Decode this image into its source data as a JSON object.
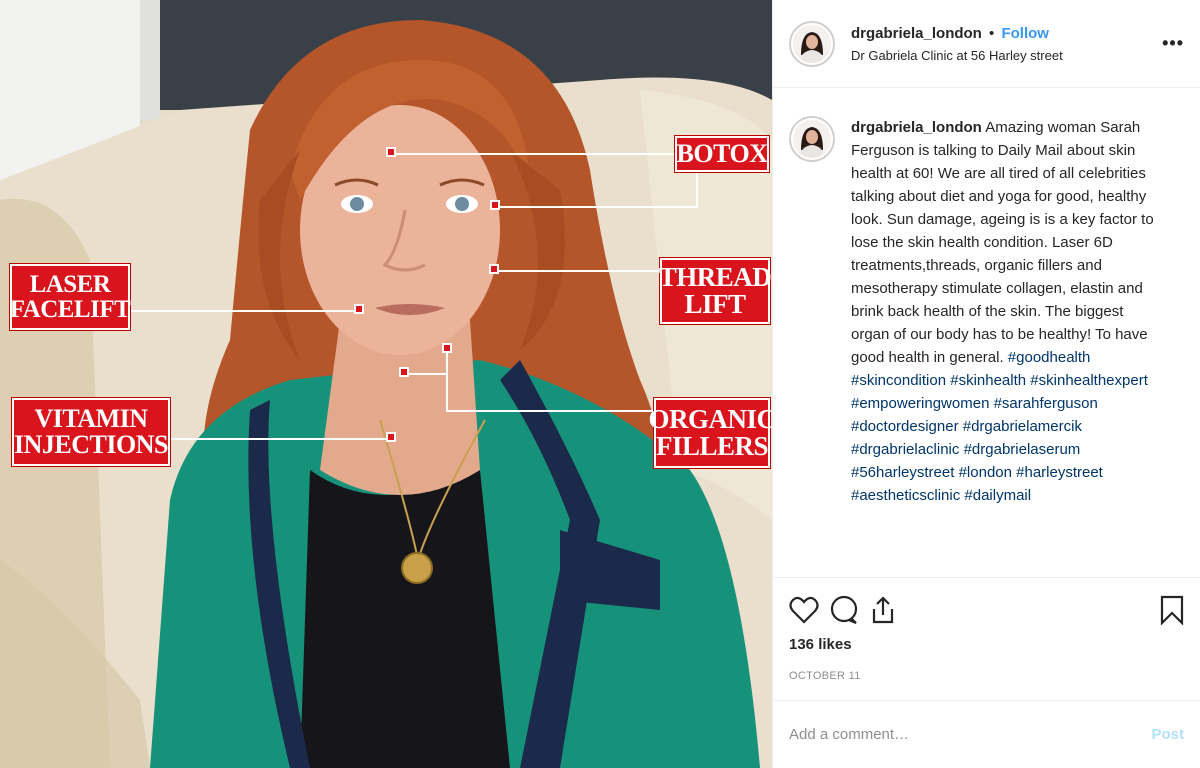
{
  "photo": {
    "callouts": [
      {
        "id": "botox",
        "text": "BOTOX"
      },
      {
        "id": "laser",
        "text": "LASER\nFACELIFT"
      },
      {
        "id": "thread",
        "text": "THREAD\nLIFT"
      },
      {
        "id": "vitamin",
        "text": "VITAMIN\nINJECTIONS"
      },
      {
        "id": "organic",
        "text": "ORGANIC\nFILLERS"
      }
    ]
  },
  "header": {
    "username": "drgabriela_london",
    "separator": "•",
    "follow_label": "Follow",
    "location": "Dr Gabriela Clinic at 56 Harley street",
    "more_label": "•••"
  },
  "caption": {
    "username": "drgabriela_london",
    "text": "Amazing woman Sarah Ferguson is talking to Daily Mail about skin health at 60! We are all tired of all celebrities talking about diet and yoga for good, healthy look. Sun damage, ageing is is a key factor to lose the skin health condition. Laser 6D treatments,threads, organic fillers and mesotherapy stimulate collagen, elastin and brink back health of the skin. The biggest organ of our body has to be healthy! To have good health in general.",
    "hashtags": [
      "#goodhealth",
      "#skincondition",
      "#skinhealth",
      "#skinhealthexpert",
      "#empoweringwomen",
      "#sarahferguson",
      "#doctordesigner",
      "#drgabrielamercik",
      "#drgabrielaclinic",
      "#drgabrielaserum",
      "#56harleystreet",
      "#london",
      "#harleystreet",
      "#aestheticsclinic",
      "#dailymail"
    ]
  },
  "actions": {
    "icons": [
      "heart-icon",
      "comment-icon",
      "share-icon",
      "bookmark-icon"
    ],
    "likes": "136 likes",
    "date": "OCTOBER 11"
  },
  "comment": {
    "placeholder": "Add a comment…",
    "post_label": "Post"
  },
  "colors": {
    "callout_red": "#d9141c",
    "blazer_green": "#17927a",
    "link_blue": "#3897f0",
    "hashtag_blue": "#003569",
    "post_disabled": "#b2dffc"
  }
}
